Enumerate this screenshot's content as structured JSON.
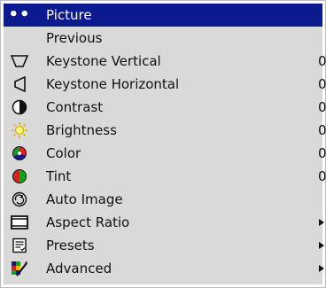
{
  "menu": {
    "title": "Picture",
    "items": [
      {
        "label": "Previous",
        "value": "",
        "icon": "none",
        "submenu": false
      },
      {
        "label": "Keystone Vertical",
        "value": "0",
        "icon": "keystone-vertical-icon",
        "submenu": false
      },
      {
        "label": "Keystone Horizontal",
        "value": "0",
        "icon": "keystone-horizontal-icon",
        "submenu": false
      },
      {
        "label": "Contrast",
        "value": "0",
        "icon": "contrast-icon",
        "submenu": false
      },
      {
        "label": "Brightness",
        "value": "0",
        "icon": "brightness-icon",
        "submenu": false
      },
      {
        "label": "Color",
        "value": "0",
        "icon": "color-icon",
        "submenu": false
      },
      {
        "label": "Tint",
        "value": "0",
        "icon": "tint-icon",
        "submenu": false
      },
      {
        "label": "Auto Image",
        "value": "",
        "icon": "auto-image-icon",
        "submenu": false
      },
      {
        "label": "Aspect Ratio",
        "value": "",
        "icon": "aspect-ratio-icon",
        "submenu": true
      },
      {
        "label": "Presets",
        "value": "",
        "icon": "presets-icon",
        "submenu": true
      },
      {
        "label": "Advanced",
        "value": "",
        "icon": "advanced-icon",
        "submenu": true
      }
    ]
  },
  "colors": {
    "header_bg": "#0c1a8f",
    "menu_bg": "#d9d9d9",
    "text": "#111111"
  }
}
